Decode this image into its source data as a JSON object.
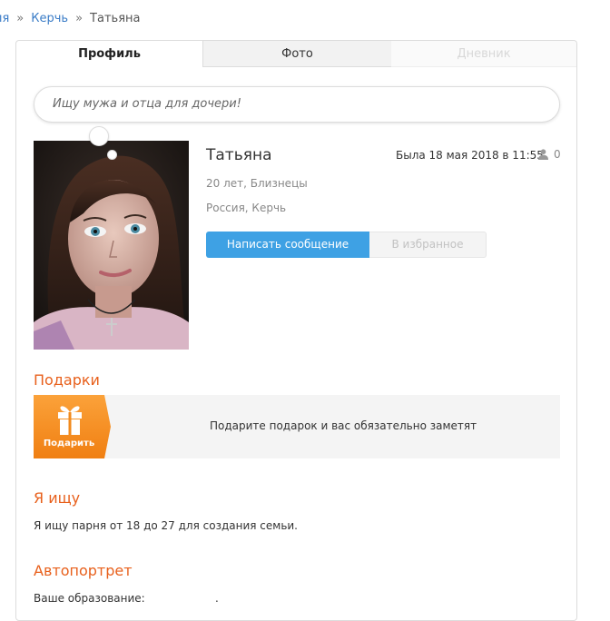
{
  "breadcrumb": {
    "items": [
      {
        "label": "ия"
      },
      {
        "label": "Керчь"
      },
      {
        "label": "Татьяна"
      }
    ],
    "separator": "»"
  },
  "tabs": [
    {
      "label": "Профиль",
      "active": true
    },
    {
      "label": "Фото",
      "active": false
    },
    {
      "label": "Дневник",
      "active": false
    }
  ],
  "profile": {
    "status": "Ищу мужа и отца для дочери!",
    "name": "Татьяна",
    "last_seen": "Была 18 мая 2018 в 11:55",
    "visits": "0",
    "age_sign": "20 лет, Близнецы",
    "location": "Россия, Керчь"
  },
  "actions": {
    "message": "Написать сообщение",
    "favorite": "В избранное"
  },
  "gifts": {
    "title": "Подарки",
    "button": "Подарить",
    "prompt": "Подарите подарок и вас обязательно заметят"
  },
  "seeking": {
    "title": "Я ищу",
    "text": "Я ищу парня от 18 до 27 для создания семьи."
  },
  "self_portrait": {
    "title": "Автопортрет",
    "education_label": "Ваше образование:",
    "education_value": "."
  },
  "colors": {
    "accent": "#e8601c",
    "link": "#3a7cc7",
    "primary_button": "#3ea1e4",
    "gift_orange": "#f7931e"
  }
}
